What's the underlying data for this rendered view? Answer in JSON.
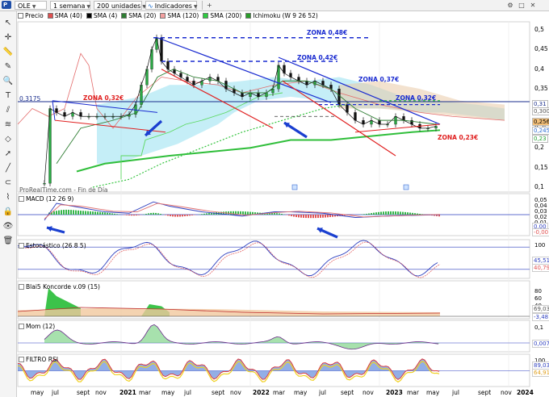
{
  "toolbar": {
    "symbol": "OLE",
    "period": "1 semana",
    "units": "200 unidades",
    "indicators": "Indicadores"
  },
  "legend": [
    {
      "label": "Precio",
      "color": "#ffffff"
    },
    {
      "label": "SMA (40)",
      "color": "#e05050"
    },
    {
      "label": "SMA (4)",
      "color": "#000000"
    },
    {
      "label": "SMA (20)",
      "color": "#2e7d32"
    },
    {
      "label": "SMA (120)",
      "color": "#f4a0a0"
    },
    {
      "label": "SMA (200)",
      "color": "#2ecc40"
    },
    {
      "label": "Ichimoku (W 9 26 52)",
      "color": "#2a9d2a"
    }
  ],
  "price_axis": [
    "0,5",
    "0,45",
    "0,4",
    "0,35",
    "0,3",
    "0,25",
    "0,2",
    "0,15",
    "0,1"
  ],
  "price_tags": [
    {
      "label": "0,31",
      "bg": "#ffffff",
      "fg": "#1a2e8c"
    },
    {
      "label": "0,300",
      "bg": "#ffffff",
      "fg": "#555555"
    },
    {
      "label": "0,256",
      "bg": "#f3c07a",
      "fg": "#000000"
    },
    {
      "label": "0,245",
      "bg": "#ffffff",
      "fg": "#2a6bd1"
    },
    {
      "label": "0,23",
      "bg": "#ffffff",
      "fg": "#1e9e2e"
    }
  ],
  "level_label": "0,3175",
  "zones": [
    {
      "label": "ZONA 0,48€",
      "color": "#1a2bd0"
    },
    {
      "label": "ZONA 0,42€",
      "color": "#1a2bd0"
    },
    {
      "label": "ZONA 0,37€",
      "color": "#1a2bd0"
    },
    {
      "label": "ZONA 0,32€",
      "color": "#1a2bd0"
    },
    {
      "label": "ZONA 0,32€",
      "color": "#e02020"
    },
    {
      "label": "ZONA 0,23€",
      "color": "#e02020"
    }
  ],
  "watermark": "ProRealTime.com - Fin de Día",
  "panels": [
    {
      "title": "MACD (12 26 9)",
      "values": [
        "0,05",
        "0,04",
        "0,03",
        "0,02",
        "0,01",
        "0",
        "-0,01"
      ],
      "tags": [
        "0,00",
        "-0,00"
      ]
    },
    {
      "title": "Estocástico (26 8 5)",
      "values": [
        "100"
      ],
      "tags": [
        "45,51",
        "40,79"
      ]
    },
    {
      "title": "Blai5 Koncorde v.09 (15)",
      "values": [
        "80",
        "60",
        "40",
        "20",
        "0"
      ],
      "tags": [
        "69,03",
        "-3,48"
      ]
    },
    {
      "title": "Mom (12)",
      "values": [
        "0,1",
        "0"
      ],
      "tags": [
        "0,007"
      ]
    },
    {
      "title": "FILTRO RSI",
      "values": [
        "100",
        "50"
      ],
      "tags": [
        "89,03",
        "64,91"
      ]
    }
  ],
  "xaxis": [
    "may",
    "jul",
    "sept",
    "nov",
    "2021",
    "mar",
    "may",
    "jul",
    "sept",
    "nov",
    "2022",
    "mar",
    "may",
    "jul",
    "sept",
    "nov",
    "2023",
    "mar",
    "may",
    "jul",
    "sept",
    "nov",
    "2024"
  ],
  "icons": {
    "left_tools": [
      "cursor-icon",
      "crosshair-icon",
      "ruler-icon",
      "pencil-icon",
      "zoom-icon",
      "text-icon",
      "channel-icon",
      "fibonacci-icon",
      "shape-icon",
      "arrow-icon",
      "line-icon",
      "magnet-icon",
      "pattern-icon",
      "lock-icon",
      "eye-icon",
      "trash-icon"
    ]
  }
}
